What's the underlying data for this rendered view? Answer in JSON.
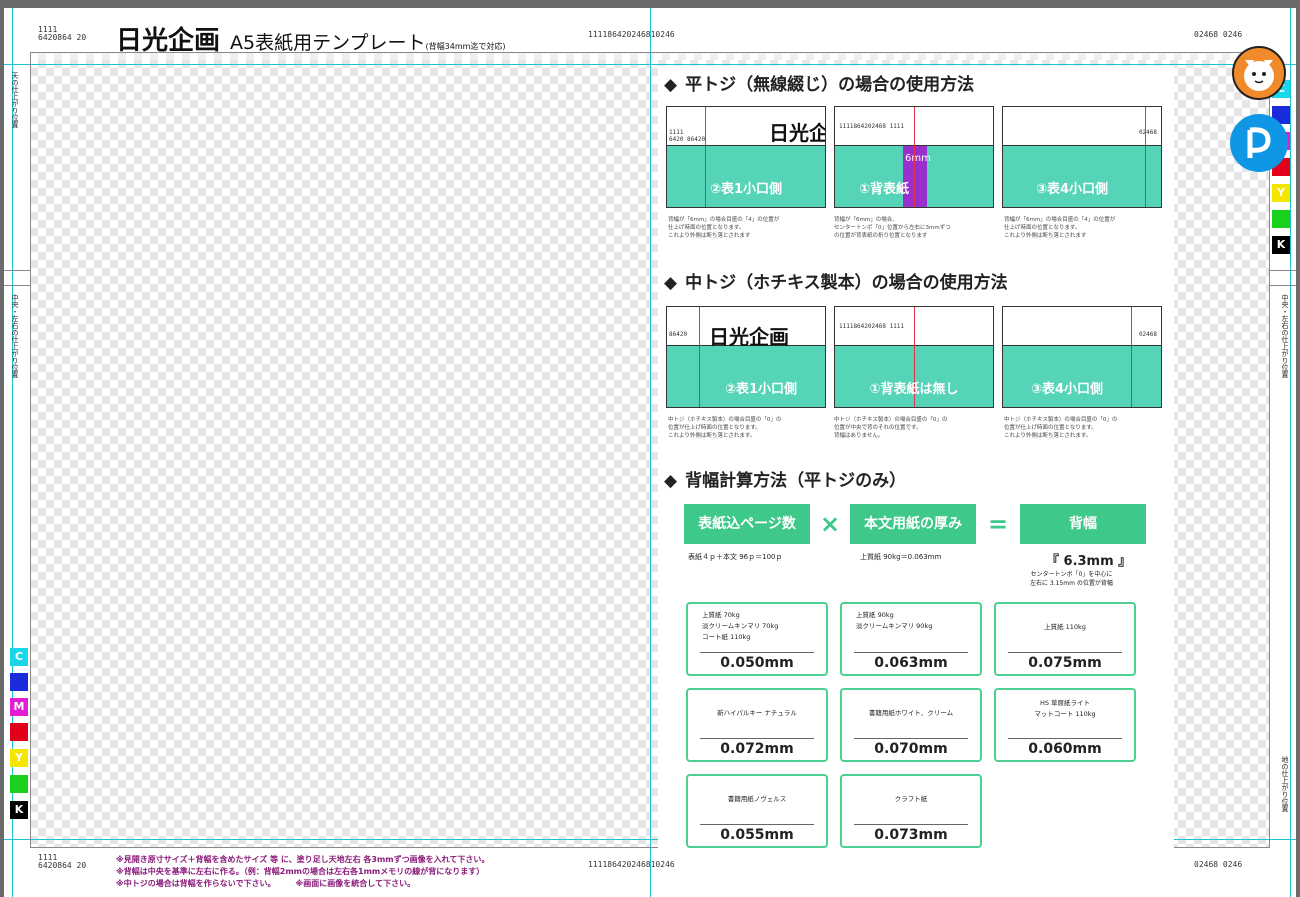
{
  "header": {
    "ruler_left": "1111\n6420864 20",
    "brand": "日光企画",
    "subtitle": "A5表紙用テンプレート",
    "note": "(背幅34mm迄で対応)",
    "ruler_center": "111186420246810246",
    "ruler_right": "02468 0246"
  },
  "side_labels": {
    "left_top": "天の仕上がり位置",
    "left_mid": "中央・左右の仕上がり位置",
    "right_mid": "中央・左右の仕上がり位置",
    "right_bottom": "地の仕上がり位置"
  },
  "swatches_left": [
    "C",
    "",
    "M",
    "",
    "Y",
    "",
    "K"
  ],
  "swatches_right": [
    "C",
    "",
    "",
    "",
    "Y",
    "",
    "K"
  ],
  "colors": {
    "cyan": "#19d6e8",
    "blue": "#1a2bd9",
    "magenta": "#e21ed5",
    "red": "#e3001b",
    "yellow": "#f5e600",
    "green": "#19d11c",
    "black": "#000000",
    "teal": "#55d4b8",
    "accent_green": "#3ec98a"
  },
  "section1": {
    "title": "平トジ（無線綴じ）の場合の使用方法",
    "thumbs": [
      {
        "big": "日光企",
        "ruler": "1111\n6420 86420",
        "label": "②表1小口側",
        "caption": "背幅が「6mm」の場合目盛の「4」の位置が\n仕上げ時面の位置となります。\nこれより外側は断ち落とされます"
      },
      {
        "big": "",
        "ruler": "1111864202468 1111",
        "label": "①背表紙",
        "tag": "6mm",
        "caption": "背幅が「6mm」の場合、\nセンタートンボ「0」位置から左右に3mmずつ\nの位置が背表紙の折り位置となります"
      },
      {
        "big": "",
        "ruler": "02468",
        "label": "③表4小口側",
        "caption": "背幅が「6mm」の場合目盛の「4」の位置が\n仕上げ時面の位置となります。\nこれより外側は断ち落とされます"
      }
    ]
  },
  "section2": {
    "title": "中トジ（ホチキス製本）の場合の使用方法",
    "thumbs": [
      {
        "big": "日光企画",
        "ruler": "86420",
        "label": "②表1小口側",
        "caption": "中トジ（ホチキス製本）の場合目盛の「0」の\n位置が仕上げ時面の位置となります。\nこれより外側は断ち落とされます。"
      },
      {
        "big": "",
        "ruler": "1111864202468 1111",
        "label": "①背表紙は無し",
        "caption": "中トジ（ホチキス製本）の場合目盛の「0」の\n位置が中央で背のそれの位置です。\n背幅はありません。"
      },
      {
        "big": "",
        "ruler": "02468",
        "label": "③表4小口側",
        "caption": "中トジ（ホチキス製本）の場合目盛の「0」の\n位置が仕上げ時面の位置となります。\nこれより外側は断ち落とされます。"
      }
    ]
  },
  "section3": {
    "title": "背幅計算方法（平トジのみ）",
    "box1": "表紙込ページ数",
    "op1": "×",
    "box2": "本文用紙の厚み",
    "op2": "=",
    "box3": "背幅",
    "note1": "表紙４ｐ＋本文 96ｐ＝100ｐ",
    "note2": "上質紙 90kg＝0.063mm",
    "result": "『 6.3mm 』",
    "result_note": "センタートンボ「0」を中心に\n左右に 3.15mm の位置が背幅"
  },
  "paper_cards": [
    {
      "name": "上質紙 70kg\n淡クリームキンマリ 70kg\nコート紙 110kg",
      "value": "0.050mm"
    },
    {
      "name": "上質紙 90kg\n淡クリームキンマリ 90kg",
      "value": "0.063mm"
    },
    {
      "name": "上質紙 110kg",
      "value": "0.075mm"
    },
    {
      "name": "新ハイパルキー ナチュラル",
      "value": "0.072mm"
    },
    {
      "name": "書籍用紙ホワイト、クリーム",
      "value": "0.070mm"
    },
    {
      "name": "HS 草原紙ライト\nマットコート 110kg",
      "value": "0.060mm"
    },
    {
      "name": "書籍用紙ノヴェルス",
      "value": "0.055mm"
    },
    {
      "name": "クラフト紙",
      "value": "0.073mm"
    }
  ],
  "footer": {
    "ruler_left": "1111\n6420864 20",
    "ruler_center": "111186420246810246",
    "ruler_right": "02468 0246",
    "notes": [
      "※見開き原寸サイズ＋背幅を含めたサイズ 等 に、塗り足し天地左右 各3mmずつ画像を入れて下さい。",
      "※背幅は中央を基準に左右に作る。（例：背幅2mmの場合は左右各1mmメモリの線が背になります）",
      "※中トジの場合は背幅を作らないで下さい。　　　※画面に画像を統合して下さい。"
    ]
  }
}
